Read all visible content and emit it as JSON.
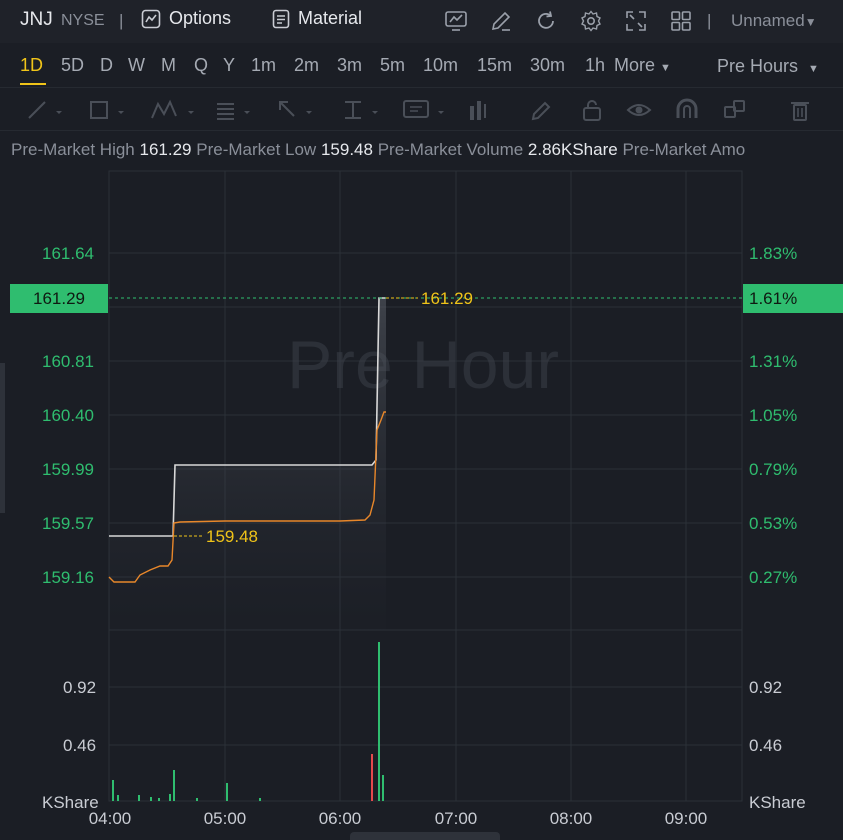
{
  "header": {
    "symbol": "JNJ",
    "exchange": "NYSE",
    "separator": "|",
    "options_label": "Options",
    "material_label": "Material",
    "layout_name": "Unnamed",
    "icons": [
      "indicator-icon",
      "draw-icon",
      "refresh-icon",
      "settings-icon",
      "fullscreen-icon",
      "layout-grid-icon"
    ]
  },
  "periods": {
    "items": [
      "1D",
      "D",
      "W",
      "M",
      "Q",
      "Y",
      "1m",
      "2m",
      "3m",
      "5m",
      "10m",
      "15m",
      "30m",
      "1h"
    ],
    "more_label": "More",
    "session_label": "Pre Hours",
    "active": "1D",
    "extra": "5D"
  },
  "stats": {
    "high_label": "Pre-Market High",
    "high_value": "161.29",
    "low_label": "Pre-Market Low",
    "low_value": "159.48",
    "volume_label": "Pre-Market Volume",
    "volume_value": "2.86KShare",
    "amount_label": "Pre-Market Amo"
  },
  "chart_data": {
    "type": "line",
    "watermark": "Pre Hour",
    "price_ticks": [
      "161.64",
      "160.81",
      "160.40",
      "159.99",
      "159.57",
      "159.16"
    ],
    "pct_ticks": [
      "1.83%",
      "1.31%",
      "1.05%",
      "0.79%",
      "0.53%",
      "0.27%"
    ],
    "current_price": "161.29",
    "current_pct": "1.61%",
    "high_annotation": "161.29",
    "low_annotation": "159.48",
    "volume_ticks": [
      "0.92",
      "0.46"
    ],
    "volume_unit": "KShare",
    "x_ticks": [
      "04:00",
      "05:00",
      "06:00",
      "07:00",
      "08:00",
      "09:00"
    ],
    "colors": {
      "up": "#2fbd6f",
      "down": "#e5484d",
      "price_line": "#d8d8d8",
      "avg_line": "#e8872a",
      "annotation": "#f0c419"
    }
  }
}
